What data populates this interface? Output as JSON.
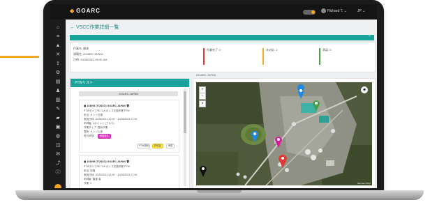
{
  "header": {
    "logo": "GOARC",
    "user": "Richard T.",
    "lang": "JP"
  },
  "page": {
    "title": "← VSCC作業詳細一覧"
  },
  "info": {
    "lines": [
      "作業名: 解体",
      "現場名: GOARC JAPAN",
      "日時: 10/26/2021 09:00 AM"
    ],
    "stats": [
      {
        "label": "作業完了: 0",
        "color": "#e53935"
      },
      {
        "label": "未対応: 2",
        "color": "#f5a623"
      },
      {
        "label": "承認: 0",
        "color": "#43a047"
      }
    ]
  },
  "ptw": {
    "header": "PTWリスト",
    "filter": "GOARC JAPAN",
    "cards": [
      {
        "lines": [
          "▣ 104994 (TCBCO) GOARC JAPAN  🗑",
          "PTWタイプ/ID: 1-A  ポンプ交換作業  PTW",
          "担当: オンジ交換",
          "実施日時: 10/26/2021 12:00 ~ 10/26/2021 17:00",
          "申請者: Vポイント (アルコ)",
          "作業タイプ: 高所作業",
          "場所: オンジ上部",
          "許可状態: "
        ],
        "status_badge": "承認待ち",
        "actions": [
          "PTW詳細",
          "許可証",
          "承認"
        ]
      },
      {
        "lines": [
          "▣ 104998 (TCBCO) GOARC JAPAN  🗑",
          "PTWタイプ/ID: 1-B  ポンプ交換作業  PTW",
          "担当: 待機",
          "実施日時: 10/26/2021 12:00 ~ 10/26/2021 17:00",
          "申請者: 審査 者",
          "作業: 3"
        ],
        "status_badge": "",
        "actions": []
      }
    ]
  },
  "map": {
    "label": "GOARC JAPAN",
    "zoom_in": "+",
    "zoom_out": "−",
    "close": "×",
    "attribution": "Map data ©2021",
    "pins": [
      {
        "name": "pin-blue-1",
        "color": "#1e88e5"
      },
      {
        "name": "pin-green",
        "color": "#43a047"
      },
      {
        "name": "pin-blue-2",
        "color": "#1e88e5"
      },
      {
        "name": "pin-magenta",
        "color": "#d81b9c"
      },
      {
        "name": "pin-red",
        "color": "#e53935"
      },
      {
        "name": "pin-black",
        "color": "#111111"
      }
    ]
  },
  "sidebar_icons": [
    "home-icon",
    "layers-icon",
    "warning-icon",
    "tools-icon",
    "upload-icon",
    "gear-icon",
    "document-icon",
    "users-icon",
    "chart-icon",
    "edit-icon",
    "truck-icon",
    "box-icon",
    "chat-icon",
    "calendar-icon",
    "message-icon",
    "share-icon",
    "info-icon"
  ]
}
